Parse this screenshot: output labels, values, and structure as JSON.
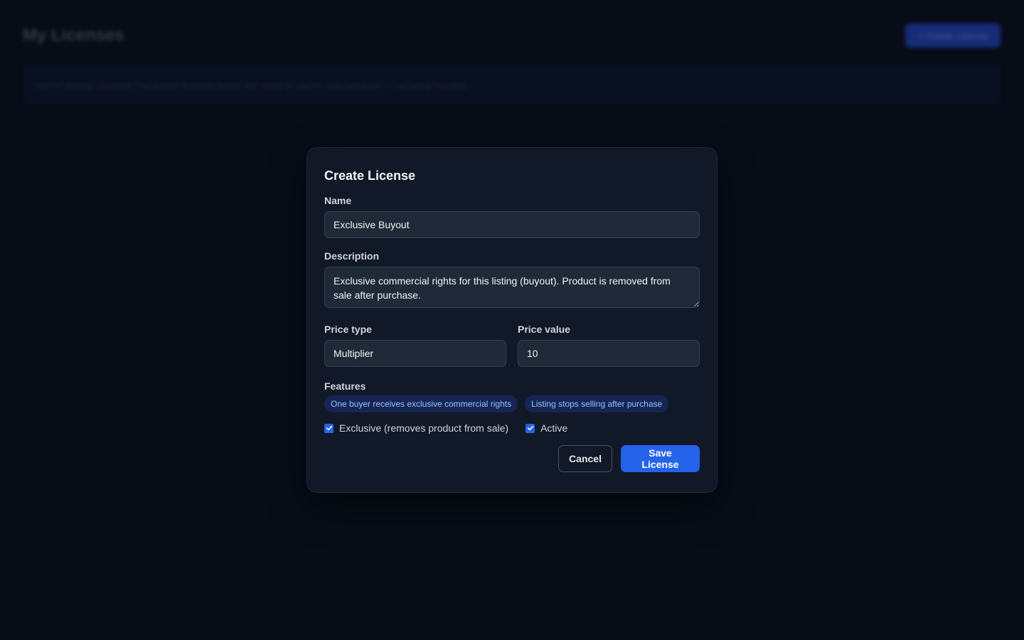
{
  "background": {
    "page_title": "My Licenses",
    "create_button": "+ Create License",
    "banner_text": "You're already covered! The preset licenses below are ready to use on your products — no setup needed."
  },
  "modal": {
    "title": "Create License",
    "name_label": "Name",
    "name_value": "Exclusive Buyout",
    "description_label": "Description",
    "description_value": "Exclusive commercial rights for this listing (buyout). Product is removed from sale after purchase.",
    "price_type_label": "Price type",
    "price_type_value": "Multiplier",
    "price_value_label": "Price value",
    "price_value_value": "10",
    "features_label": "Features",
    "features": [
      "One buyer receives exclusive commercial rights",
      "Listing stops selling after purchase"
    ],
    "exclusive_label": "Exclusive (removes product from sale)",
    "exclusive_checked": true,
    "active_label": "Active",
    "active_checked": true,
    "cancel_label": "Cancel",
    "save_label": "Save License"
  },
  "colors": {
    "accent": "#2563eb",
    "background": "#090e1b",
    "modal": "#111827"
  }
}
